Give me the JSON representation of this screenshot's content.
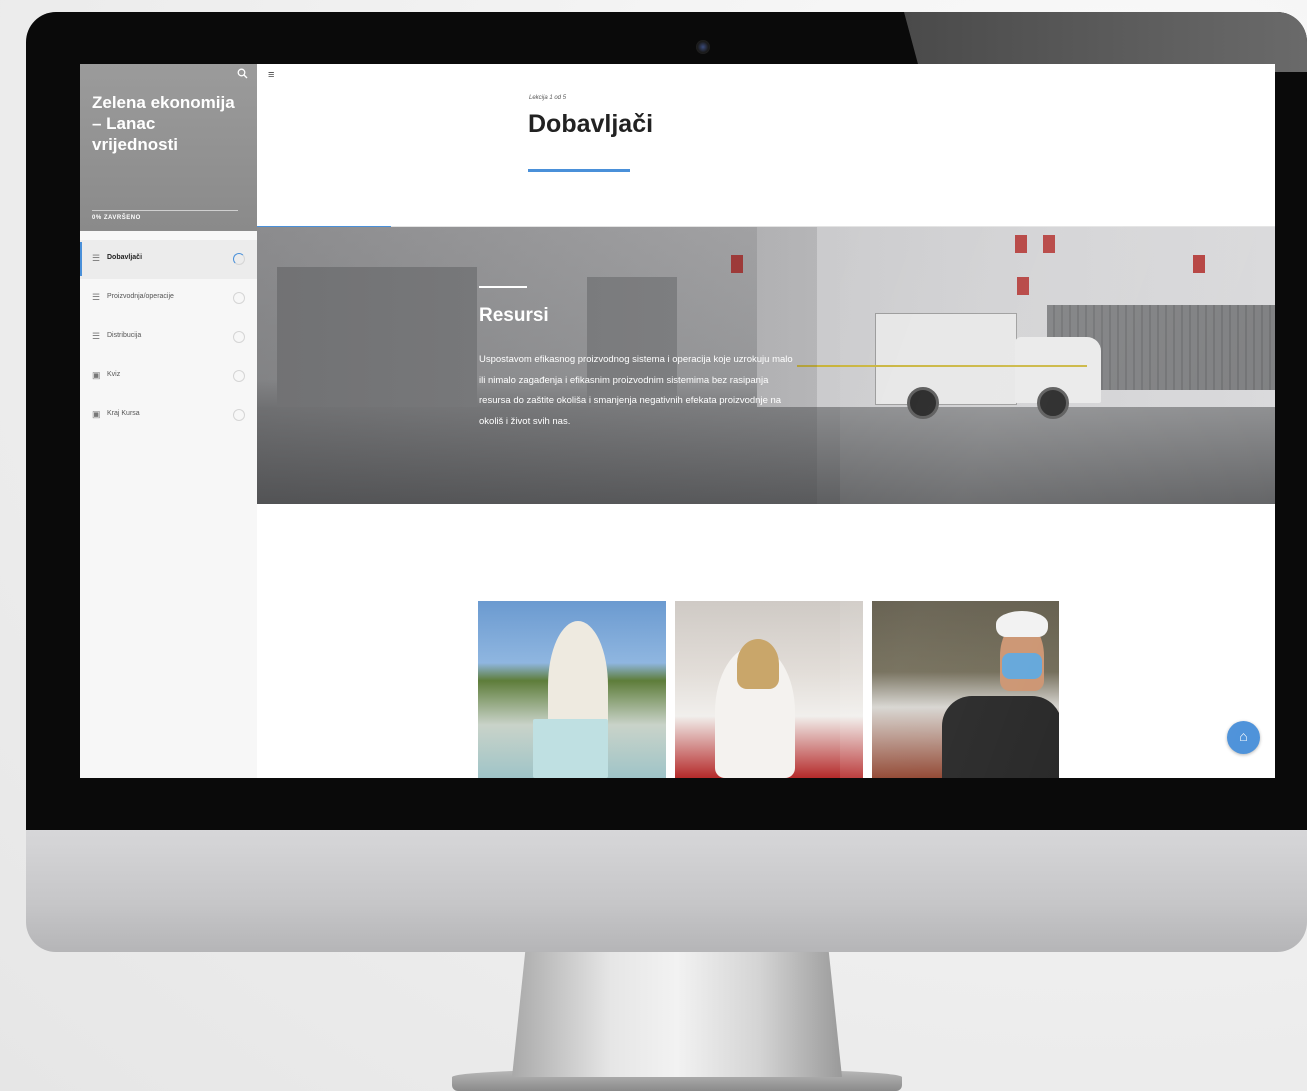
{
  "sidebar": {
    "course_title": "Zelena ekonomija – Lanac vrijednosti",
    "progress_label": "0% ZAVRŠENO",
    "lessons": [
      {
        "label": "Dobavljači",
        "icon": "text-lines-icon",
        "active": true
      },
      {
        "label": "Proizvodnja/operacije",
        "icon": "text-lines-icon",
        "active": false
      },
      {
        "label": "Distribucija",
        "icon": "text-lines-icon",
        "active": false
      },
      {
        "label": "Kviz",
        "icon": "quiz-icon",
        "active": false
      },
      {
        "label": "Kraj Kursa",
        "icon": "quiz-icon",
        "active": false
      }
    ]
  },
  "header": {
    "lesson_counter": "Lekcija 1 od 5",
    "lesson_title": "Dobavljači"
  },
  "hero": {
    "title": "Resursi",
    "text": "Uspostavom efikasnog proizvodnog sistema i operacija koje uzrokuju malo ili nimalo zagađenja i efikasnim proizvodnim sistemima bez rasipanja resursa do zaštite okoliša i smanjenja negativnih efekata proizvodnje na okoliš i život svih nas."
  },
  "colors": {
    "accent": "#4a90d9",
    "sidebar_header": "#959595",
    "bezel": "#0a0a0a"
  },
  "icons": {
    "search": "search-icon",
    "menu": "hamburger-menu-icon",
    "home": "home-icon"
  }
}
